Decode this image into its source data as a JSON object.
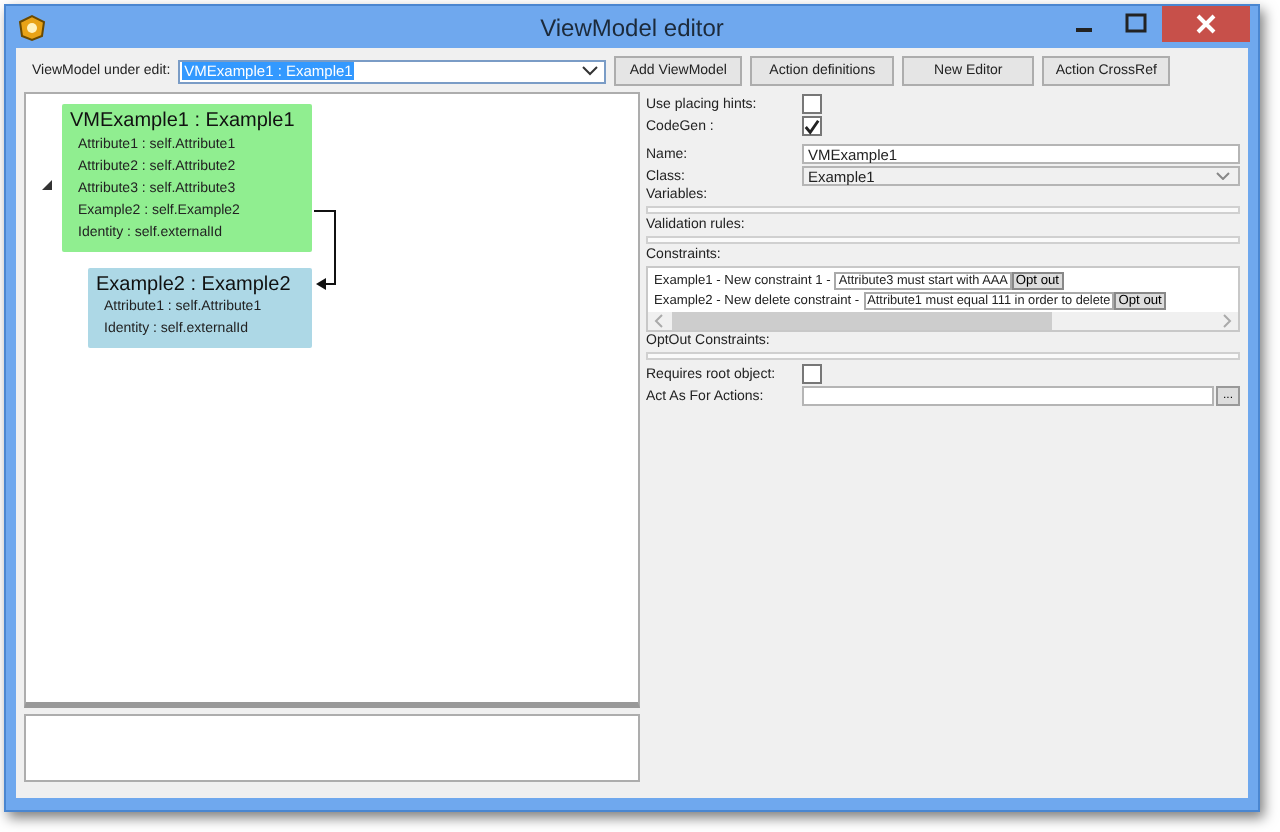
{
  "window": {
    "title": "ViewModel editor"
  },
  "toolbar": {
    "label": "ViewModel under edit:",
    "combo_value": "VMExample1 : Example1",
    "buttons": [
      "Add ViewModel",
      "Action definitions",
      "New Editor",
      "Action CrossRef"
    ]
  },
  "diagram": {
    "nodes": [
      {
        "title": "VMExample1 : Example1",
        "color": "#90ee90",
        "attributes": [
          "Attribute1 : self.Attribute1",
          "Attribute2 : self.Attribute2",
          "Attribute3 : self.Attribute3",
          "Example2 : self.Example2",
          "Identity : self.externalId"
        ]
      },
      {
        "title": "Example2 : Example2",
        "color": "#add8e6",
        "attributes": [
          "Attribute1 : self.Attribute1",
          "Identity : self.externalId"
        ]
      }
    ]
  },
  "properties": {
    "checkboxes": [
      {
        "label": "Use placing hints:",
        "checked": false
      },
      {
        "label": "CodeGen :",
        "checked": true
      }
    ],
    "name": {
      "label": "Name:",
      "value": "VMExample1"
    },
    "class": {
      "label": "Class:",
      "value": "Example1"
    },
    "sections": [
      "Variables:",
      "Validation rules:"
    ],
    "constraints_label": "Constraints:",
    "constraints": [
      {
        "text": "Example1 - New constraint 1 -",
        "message": "Attribute3 must start with AAA",
        "button": "Opt out"
      },
      {
        "text": "Example2 - New delete constraint -",
        "message": "Attribute1 must equal 111 in order to delete",
        "button": "Opt out"
      }
    ],
    "optout_label": "OptOut Constraints:",
    "requires_root": {
      "label": "Requires root object:",
      "checked": false
    },
    "act_as": {
      "label": "Act As For Actions:",
      "button": "..."
    }
  }
}
